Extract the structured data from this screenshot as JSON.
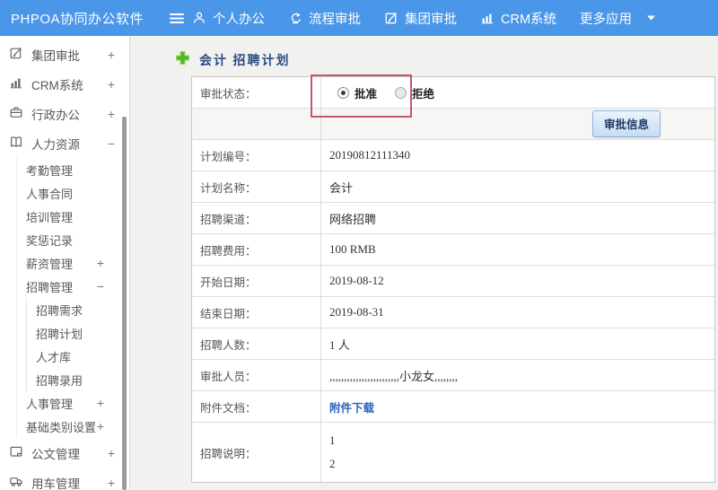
{
  "colors": {
    "navbar_bg": "#4a96e8",
    "annotation_red": "#c4566b",
    "link_blue": "#2b62c2",
    "title_navy": "#2a4d84",
    "plus_green": "#55b42c"
  },
  "navbar": {
    "brand": "PHPOA协同办公软件",
    "items": [
      {
        "label": "个人办公",
        "icon": "user-icon"
      },
      {
        "label": "流程审批",
        "icon": "workflow-icon"
      },
      {
        "label": "集团审批",
        "icon": "edit-icon"
      },
      {
        "label": "CRM系统",
        "icon": "bar-chart-icon"
      },
      {
        "label": "更多应用",
        "icon": "caret-down-icon"
      }
    ]
  },
  "sidebar": {
    "items": [
      {
        "label": "集团审批",
        "icon": "edit-icon",
        "toggle": "+",
        "level": 0
      },
      {
        "label": "CRM系统",
        "icon": "bar-chart-icon",
        "toggle": "+",
        "level": 0
      },
      {
        "label": "行政办公",
        "icon": "briefcase-icon",
        "toggle": "+",
        "level": 0
      },
      {
        "label": "人力资源",
        "icon": "book-icon",
        "toggle": "−",
        "level": 0
      },
      {
        "label": "考勤管理",
        "level": 1
      },
      {
        "label": "人事合同",
        "level": 1
      },
      {
        "label": "培训管理",
        "level": 1
      },
      {
        "label": "奖惩记录",
        "level": 1
      },
      {
        "label": "薪资管理",
        "toggle": "+",
        "level": 1
      },
      {
        "label": "招聘管理",
        "toggle": "−",
        "level": 1
      },
      {
        "label": "招聘需求",
        "level": 2
      },
      {
        "label": "招聘计划",
        "level": 2
      },
      {
        "label": "人才库",
        "level": 2
      },
      {
        "label": "招聘录用",
        "level": 2
      },
      {
        "label": "人事管理",
        "toggle": "+",
        "level": 1
      },
      {
        "label": "基础类别设置",
        "toggle": "+",
        "level": 1
      },
      {
        "label": "公文管理",
        "icon": "document-icon",
        "toggle": "+",
        "level": 0
      },
      {
        "label": "用车管理",
        "icon": "truck-icon",
        "toggle": "+",
        "level": 0
      }
    ]
  },
  "main": {
    "title": "会计 招聘计划",
    "approval": {
      "label": "审批状态：",
      "options": [
        {
          "label": "批准",
          "selected": true
        },
        {
          "label": "拒绝",
          "selected": false
        }
      ]
    },
    "approve_button": "审批信息",
    "fields": [
      {
        "label": "计划编号：",
        "value": "20190812111340"
      },
      {
        "label": "计划名称：",
        "value": "会计"
      },
      {
        "label": "招聘渠道：",
        "value": "网络招聘"
      },
      {
        "label": "招聘费用：",
        "value": "100 RMB"
      },
      {
        "label": "开始日期：",
        "value": "2019-08-12"
      },
      {
        "label": "结束日期：",
        "value": "2019-08-31"
      },
      {
        "label": "招聘人数：",
        "value": "1 人"
      },
      {
        "label": "审批人员：",
        "value": ",,,,,,,,,,,,,,,,,,,,,,,,小龙女,,,,,,,,"
      },
      {
        "label": "附件文档：",
        "value": "附件下载"
      },
      {
        "label": "招聘说明：",
        "line1": "1",
        "line2": "2"
      }
    ]
  }
}
